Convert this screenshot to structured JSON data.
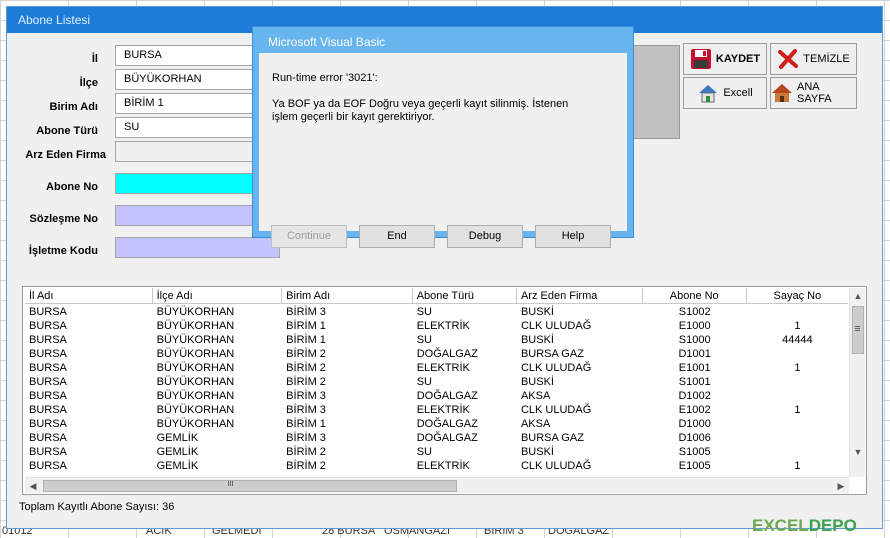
{
  "form": {
    "title": "Abone Listesi",
    "fields": {
      "il": {
        "label": "İl",
        "value": "BURSA"
      },
      "ilce": {
        "label": "İlçe",
        "value": "BÜYÜKORHAN"
      },
      "birim": {
        "label": "Birim Adı",
        "value": "BİRİM 1"
      },
      "abone_turu": {
        "label": "Abone Türü",
        "value": "SU"
      },
      "arz_eden": {
        "label": "Arz Eden Firma",
        "value": ""
      },
      "abone_no": {
        "label": "Abone No",
        "value": ""
      },
      "sozlesme_no": {
        "label": "Sözleşme No",
        "value": ""
      },
      "isletme_kodu": {
        "label": "İşletme Kodu",
        "value": ""
      }
    },
    "buttons": {
      "kaydet": "KAYDET",
      "temizle": "TEMİZLE",
      "excell": "Excell",
      "ana_sayfa": "ANA SAYFA"
    },
    "list": {
      "columns": [
        "İl Adı",
        "İlçe Adı",
        "Birim Adı",
        "Abone Türü",
        "Arz Eden Firma",
        "Abone No",
        "Sayaç No"
      ],
      "rows": [
        [
          "BURSA",
          "BÜYÜKORHAN",
          "BİRİM 3",
          "SU",
          "BUSKİ",
          "S1002",
          ""
        ],
        [
          "BURSA",
          "BÜYÜKORHAN",
          "BİRİM 1",
          "ELEKTRİK",
          "CLK ULUDAĞ",
          "E1000",
          "1"
        ],
        [
          "BURSA",
          "BÜYÜKORHAN",
          "BİRİM 1",
          "SU",
          "BUSKİ",
          "S1000",
          "44444"
        ],
        [
          "BURSA",
          "BÜYÜKORHAN",
          "BİRİM 2",
          "DOĞALGAZ",
          "BURSA GAZ",
          "D1001",
          ""
        ],
        [
          "BURSA",
          "BÜYÜKORHAN",
          "BİRİM 2",
          "ELEKTRİK",
          "CLK ULUDAĞ",
          "E1001",
          "1"
        ],
        [
          "BURSA",
          "BÜYÜKORHAN",
          "BİRİM 2",
          "SU",
          "BUSKİ",
          "S1001",
          ""
        ],
        [
          "BURSA",
          "BÜYÜKORHAN",
          "BİRİM 3",
          "DOĞALGAZ",
          "AKSA",
          "D1002",
          ""
        ],
        [
          "BURSA",
          "BÜYÜKORHAN",
          "BİRİM 3",
          "ELEKTRİK",
          "CLK ULUDAĞ",
          "E1002",
          "1"
        ],
        [
          "BURSA",
          "BÜYÜKORHAN",
          "BİRİM 1",
          "DOĞALGAZ",
          "AKSA",
          "D1000",
          ""
        ],
        [
          "BURSA",
          "GEMLİK",
          "BİRİM 3",
          "DOĞALGAZ",
          "BURSA GAZ",
          "D1006",
          ""
        ],
        [
          "BURSA",
          "GEMLİK",
          "BİRİM 2",
          "SU",
          "BUSKİ",
          "S1005",
          ""
        ],
        [
          "BURSA",
          "GEMLİK",
          "BİRİM 2",
          "ELEKTRİK",
          "CLK ULUDAĞ",
          "E1005",
          "1"
        ]
      ]
    },
    "footer": "Toplam Kayıtlı Abone Sayısı: 36"
  },
  "dialog": {
    "title": "Microsoft Visual Basic",
    "error": "Run-time error '3021':",
    "message": "Ya BOF ya da EOF Doğru veya geçerli kayıt silinmiş. İstenen işlem geçerli bir kayıt gerektiriyor.",
    "buttons": {
      "continue": "Continue",
      "end": "End",
      "debug": "Debug",
      "help": "Help"
    }
  },
  "background": {
    "row_cells": [
      "ACIK",
      "GELMEDI",
      "28 BURSA",
      "OSMANGAZI",
      "BIRIM 3",
      "DOGALGAZ"
    ],
    "partial_cell": "01012"
  },
  "watermark": {
    "part1": "EXCEL",
    "part2": "DEPO"
  },
  "colors": {
    "titlebar": "#1e7bd6",
    "dialog_frame": "#67b4ee",
    "abone_no_bg": "#00ffff",
    "lavender": "#c3c3ff"
  }
}
